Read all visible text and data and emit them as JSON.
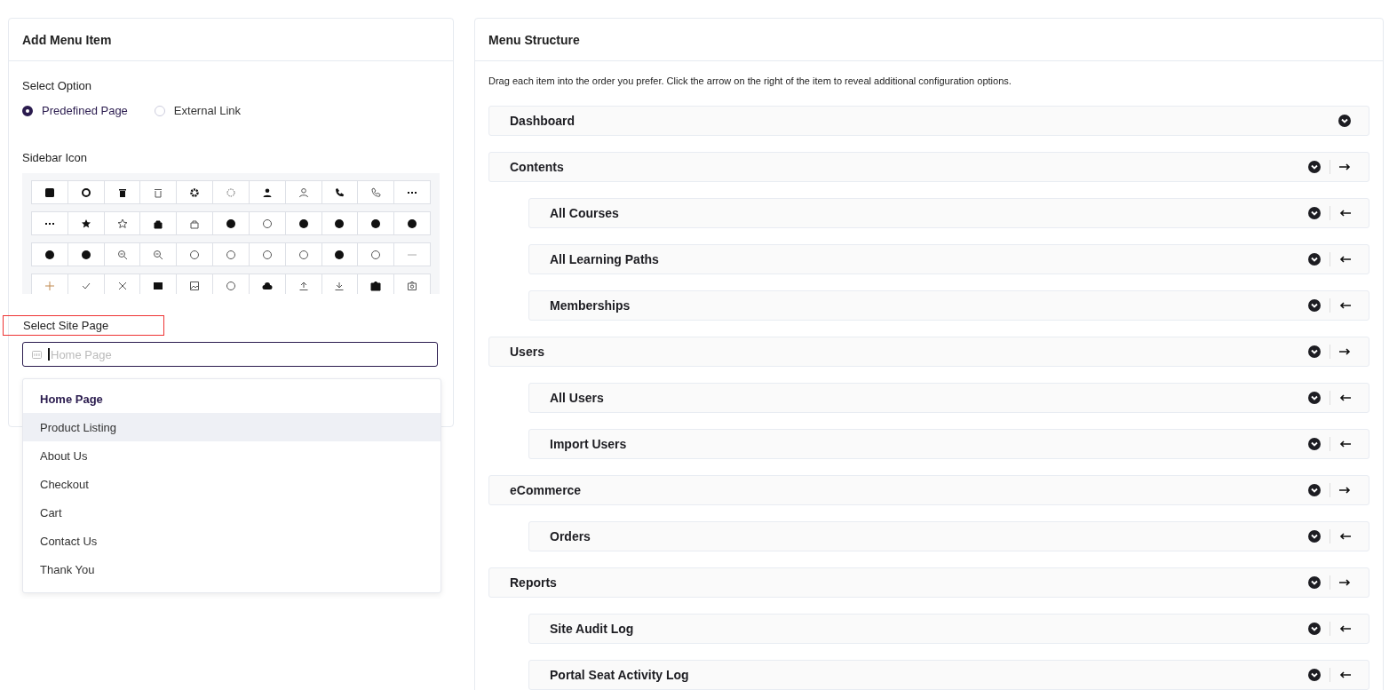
{
  "add_panel": {
    "title": "Add Menu Item",
    "select_option": {
      "label": "Select Option",
      "options": [
        {
          "label": "Predefined Page",
          "selected": true
        },
        {
          "label": "External Link",
          "selected": false
        }
      ]
    },
    "sidebar_icon": {
      "label": "Sidebar Icon"
    },
    "site_page": {
      "label": "Select Site Page",
      "highlighted": true,
      "placeholder": "Home Page",
      "options": [
        {
          "label": "Home Page",
          "selected": true,
          "hovered": false
        },
        {
          "label": "Product Listing",
          "selected": false,
          "hovered": true
        },
        {
          "label": "About Us",
          "selected": false,
          "hovered": false
        },
        {
          "label": "Checkout",
          "selected": false,
          "hovered": false
        },
        {
          "label": "Cart",
          "selected": false,
          "hovered": false
        },
        {
          "label": "Contact Us",
          "selected": false,
          "hovered": false
        },
        {
          "label": "Thank You",
          "selected": false,
          "hovered": false
        }
      ]
    }
  },
  "structure_panel": {
    "title": "Menu Structure",
    "hint": "Drag each item into the order you prefer. Click the arrow on the right of the item to reveal additional configuration options.",
    "items": [
      {
        "label": "Dashboard"
      },
      {
        "label": "Contents",
        "children": [
          {
            "label": "All Courses"
          },
          {
            "label": "All Learning Paths"
          },
          {
            "label": "Memberships"
          }
        ]
      },
      {
        "label": "Users",
        "children": [
          {
            "label": "All Users"
          },
          {
            "label": "Import Users"
          }
        ]
      },
      {
        "label": "eCommerce",
        "children": [
          {
            "label": "Orders"
          }
        ]
      },
      {
        "label": "Reports",
        "children": [
          {
            "label": "Site Audit Log"
          },
          {
            "label": "Portal Seat Activity Log"
          }
        ]
      }
    ]
  }
}
